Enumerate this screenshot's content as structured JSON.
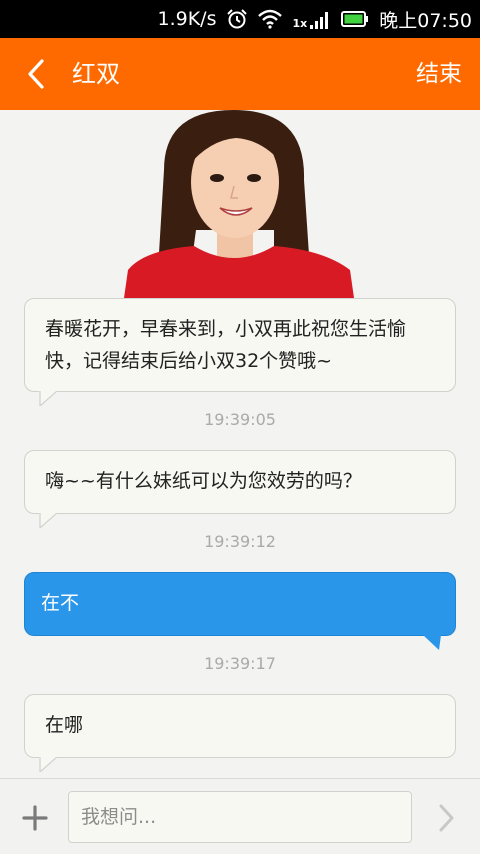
{
  "status_bar": {
    "net_speed": "1.9K/s",
    "signal_label": "1x",
    "time": "晚上07:50",
    "icons": [
      "alarm-icon",
      "wifi-icon",
      "signal-icon",
      "battery-icon"
    ]
  },
  "header": {
    "back_icon": "chevron-left-icon",
    "title": "红双",
    "end_label": "结束"
  },
  "chat": {
    "messages": [
      {
        "side": "left",
        "text": "春暖花开，早春来到，小双再此祝您生活愉快，记得结束后给小双32个赞哦~",
        "time": "19:39:05"
      },
      {
        "side": "left",
        "text": "嗨~~有什么妹纸可以为您效劳的吗？",
        "time": "19:39:12"
      },
      {
        "side": "right",
        "text": "在不",
        "time": "19:39:17"
      },
      {
        "side": "left",
        "text": "在哪"
      }
    ]
  },
  "input_bar": {
    "placeholder": "我想问...",
    "plus_icon": "plus-icon",
    "send_icon": "chevron-right-icon"
  },
  "colors": {
    "accent": "#ff6a00",
    "user_bubble": "#2a96ea",
    "agent_bubble": "#f6f8f1"
  }
}
